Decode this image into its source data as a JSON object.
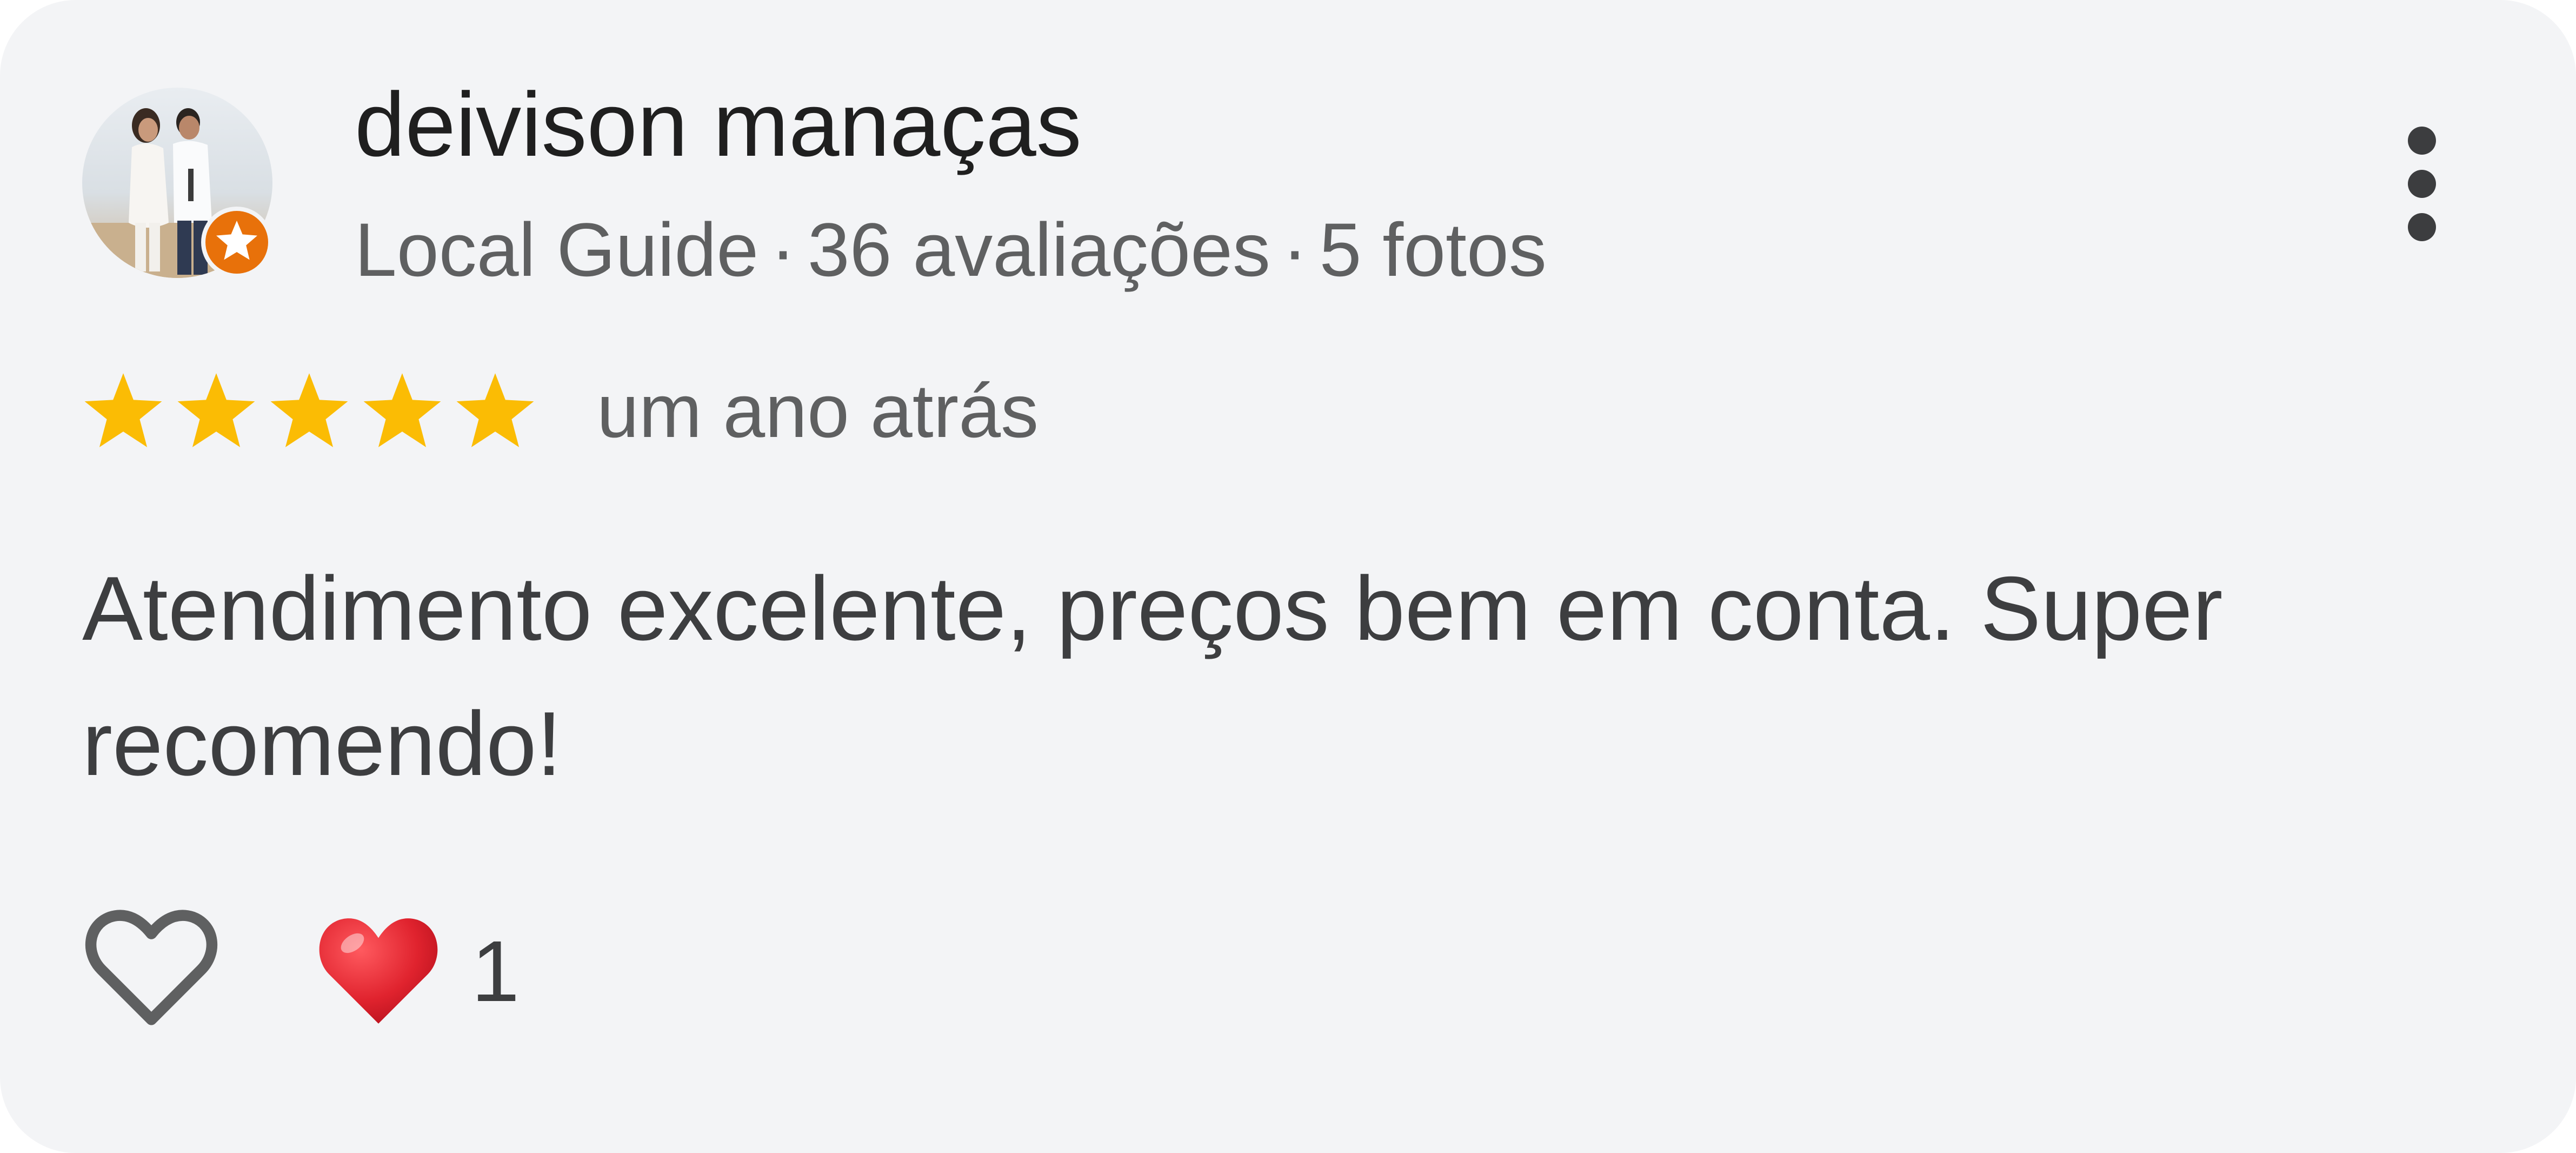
{
  "review": {
    "reviewer_name": "deivison manaças",
    "badge": "Local Guide",
    "separator": "·",
    "review_count": "36 avaliações",
    "photo_count": "5 fotos",
    "rating": 5,
    "max_rating": 5,
    "date": "um ano atrás",
    "text": "Atendimento excelente, preços bem em conta. Super recomendo!",
    "reaction_count": "1"
  },
  "icons": {
    "avatar": "profile-photo",
    "badge": "local-guide-star-badge",
    "more": "more-vert-icon",
    "star": "star-icon",
    "like": "heart-outline-icon",
    "reaction": "red-heart-emoji"
  },
  "colors": {
    "star": "#fbbc04",
    "guide_badge": "#e8710a",
    "heart_reaction": "#e0232e",
    "card_background": "#f3f4f6"
  }
}
